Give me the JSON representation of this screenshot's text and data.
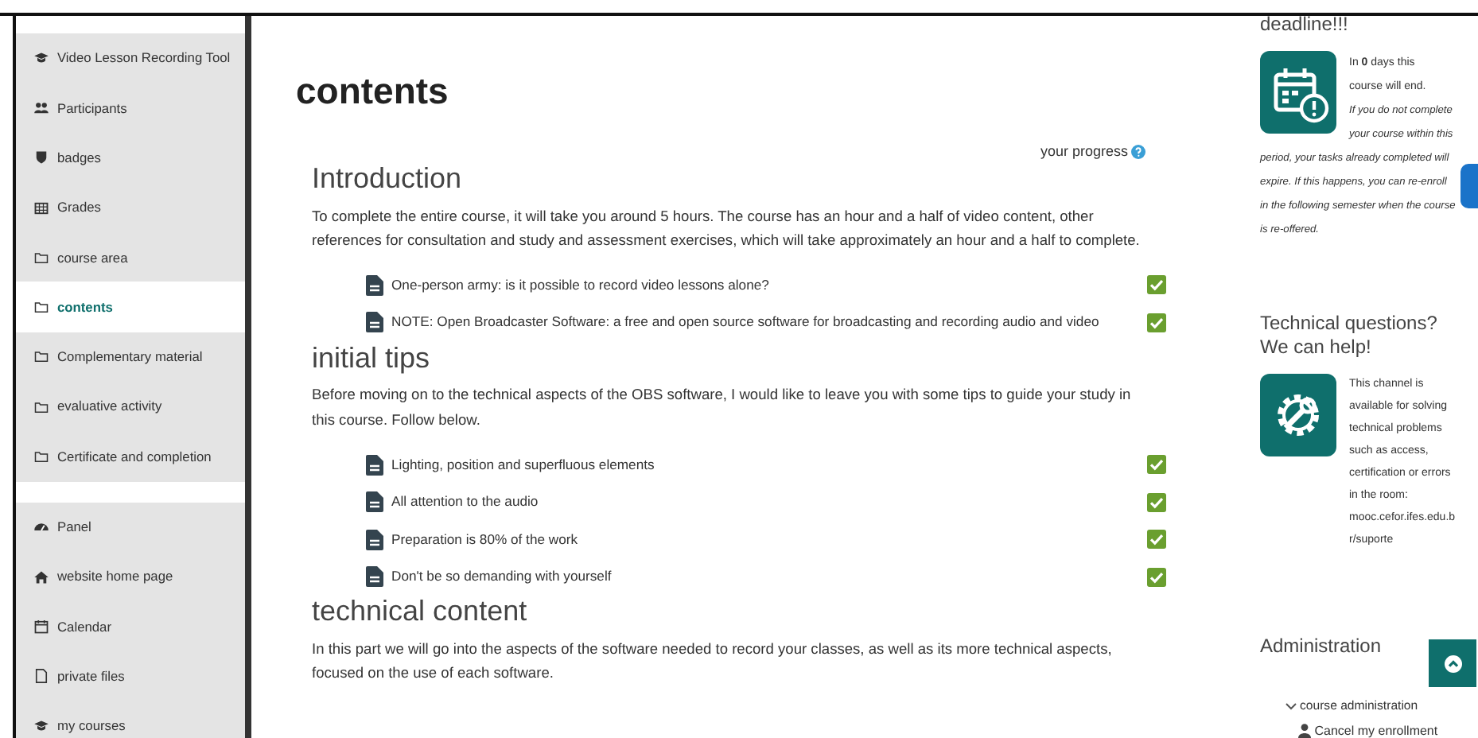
{
  "sidebar": {
    "groups": [
      {
        "items": [
          {
            "label": "Video Lesson Recording Tool",
            "selected": false
          },
          {
            "label": "Participants",
            "selected": false
          },
          {
            "label": "badges",
            "selected": false
          },
          {
            "label": "Grades",
            "selected": false
          },
          {
            "label": "course area",
            "selected": false
          },
          {
            "label": "contents",
            "selected": true
          },
          {
            "label": "Complementary material",
            "selected": false
          },
          {
            "label": "evaluative activity",
            "selected": false
          },
          {
            "label": "Certificate and completion",
            "selected": false
          }
        ]
      },
      {
        "items": [
          {
            "label": "Panel",
            "selected": false
          },
          {
            "label": "website home page",
            "selected": false
          },
          {
            "label": "Calendar",
            "selected": false
          },
          {
            "label": "private files",
            "selected": false
          },
          {
            "label": "my courses",
            "selected": false
          }
        ]
      }
    ]
  },
  "page_title": "contents",
  "progress_label": "your progress",
  "sections": [
    {
      "title": "Introduction",
      "summary": "To complete the entire course, it will take you around 5 hours. The course has an hour and a half of video content, other references for consultation and study and assessment exercises, which will take approximately an hour and a half to complete.",
      "activities": [
        {
          "label": "One-person army: is it possible to record video lessons alone?",
          "completed": true
        },
        {
          "label": "NOTE: Open Broadcaster Software: a free and open source software for broadcasting and recording audio and video",
          "completed": true
        }
      ]
    },
    {
      "title": "initial tips",
      "summary": "Before moving on to the technical aspects of the OBS software, I would like to leave you with some tips to guide your study in this course. Follow below.",
      "activities": [
        {
          "label": "Lighting, position and superfluous elements",
          "completed": true
        },
        {
          "label": "All attention to the audio",
          "completed": true
        },
        {
          "label": "Preparation is 80% of the work",
          "completed": true
        },
        {
          "label": "Don't be so demanding with yourself",
          "completed": true
        }
      ]
    },
    {
      "title": "technical content",
      "summary": "In this part we will go into the aspects of the software needed to record your classes, as well as its more technical aspects, focused on the use of each software."
    }
  ],
  "blocks": [
    {
      "title": "deadline!!!",
      "kind": "deadline",
      "lead": "In **0** days this course will end.",
      "note": "If you do not complete your course within this period, your tasks already completed will expire. If this happens, you can re-enroll in the following semester when the course is re-offered."
    },
    {
      "title": "Technical questions? We can help!",
      "kind": "support",
      "lead": "This channel is available for solving technical problems such as access, certification or errors in the room: mooc.cefor.ifes.edu.br/suporte"
    },
    {
      "title": "Administration",
      "tree": {
        "label": "course administration",
        "expanded": true,
        "children": [
          {
            "label": "Cancel my enrollment"
          }
        ]
      }
    }
  ]
}
